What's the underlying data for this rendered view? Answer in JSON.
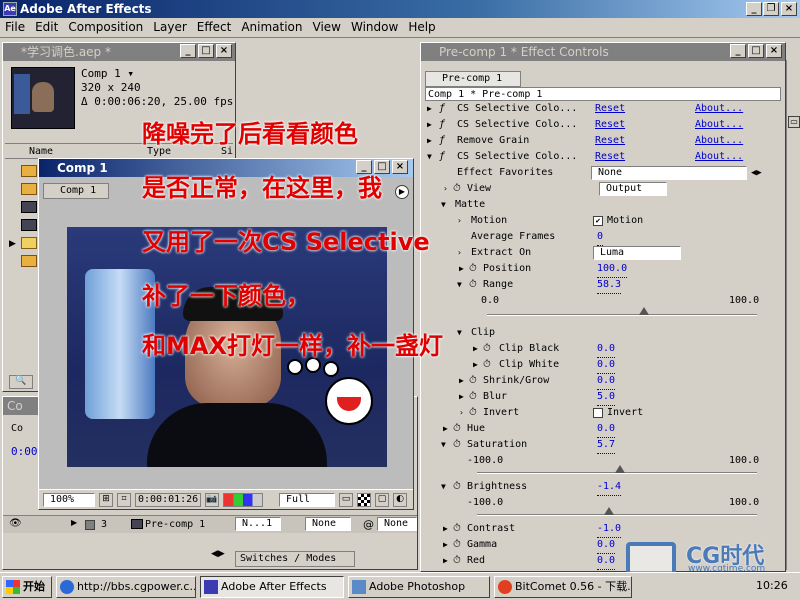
{
  "app": {
    "title": "Adobe After Effects"
  },
  "menu": [
    "File",
    "Edit",
    "Composition",
    "Layer",
    "Effect",
    "Animation",
    "View",
    "Window",
    "Help"
  ],
  "project": {
    "title": "*学习调色.aep *",
    "comp_name": "Comp 1 ▾",
    "size": "320 x 240",
    "duration": "Δ 0:00:06:20, 25.00 fps",
    "col_name": "Name",
    "col_type": "Type",
    "col_size": "Si"
  },
  "comp": {
    "title": "Comp 1",
    "tab": "Comp 1",
    "zoom": "100%",
    "time": "0:00:01:26",
    "quality": "Full"
  },
  "timeline": {
    "title": "Co",
    "tab": "Co",
    "time": "0:00",
    "layer_num": "3",
    "layer_name": "Pre-comp 1",
    "mode": "N...1",
    "trkmat": "None",
    "parent": "None",
    "switches_label": "Switches / Modes"
  },
  "effect_controls": {
    "title": "Pre-comp 1 * Effect Controls",
    "tab": "Pre-comp 1",
    "breadcrumb": "Comp 1 * Pre-comp 1",
    "effects": [
      {
        "name": "CS Selective Colo...",
        "reset": "Reset",
        "about": "About..."
      },
      {
        "name": "CS Selective Colo...",
        "reset": "Reset",
        "about": "About..."
      },
      {
        "name": "Remove Grain",
        "reset": "Reset",
        "about": "About..."
      },
      {
        "name": "CS Selective Colo...",
        "reset": "Reset",
        "about": "About..."
      }
    ],
    "effect_favorites_label": "Effect Favorites",
    "effect_favorites_value": "None",
    "view_label": "View",
    "view_value": "Output",
    "matte_label": "Matte",
    "motion_label": "Motion",
    "motion_check": "Motion",
    "avg_frames_label": "Average Frames",
    "avg_frames_value": "0",
    "extract_label": "Extract On",
    "extract_value": "Luma",
    "position_label": "Position",
    "position_value": "100.0",
    "range_label": "Range",
    "range_value": "58.3",
    "range_min": "0.0",
    "range_max": "100.0",
    "range_pct": 58.3,
    "clip_label": "Clip",
    "clip_black_label": "Clip Black",
    "clip_black_value": "0.0",
    "clip_white_label": "Clip White",
    "clip_white_value": "0.0",
    "shrink_label": "Shrink/Grow",
    "shrink_value": "0.0",
    "blur_label": "Blur",
    "blur_value": "5.0",
    "invert_label": "Invert",
    "invert_check": "Invert",
    "hue_label": "Hue",
    "hue_value": "0.0",
    "saturation_label": "Saturation",
    "saturation_value": "5.7",
    "sat_min": "-100.0",
    "sat_max": "100.0",
    "brightness_label": "Brightness",
    "brightness_value": "-1.4",
    "bri_min": "-100.0",
    "bri_max": "100.0",
    "contrast_label": "Contrast",
    "contrast_value": "-1.0",
    "gamma_label": "Gamma",
    "gamma_value": "0.0",
    "red_label": "Red",
    "red_value": "0.0"
  },
  "overlay_text": [
    "降噪完了后看看颜色",
    "是否正常，在这里，我",
    "又用了一次CS Selective",
    "补了一下颜色，",
    "和MAX打灯一样，补一盏灯"
  ],
  "watermark": {
    "brand": "CG时代",
    "url": "www.cgtime.com"
  },
  "taskbar": {
    "start": "开始",
    "items": [
      "http://bbs.cgpower.c...",
      "Adobe After Effects",
      "Adobe Photoshop",
      "BitComet 0.56 - 下载..."
    ],
    "clock": "10:26"
  },
  "colors": {
    "titlebar": "#0a246a",
    "overlay_text": "#e00000",
    "link": "#0000cc"
  }
}
